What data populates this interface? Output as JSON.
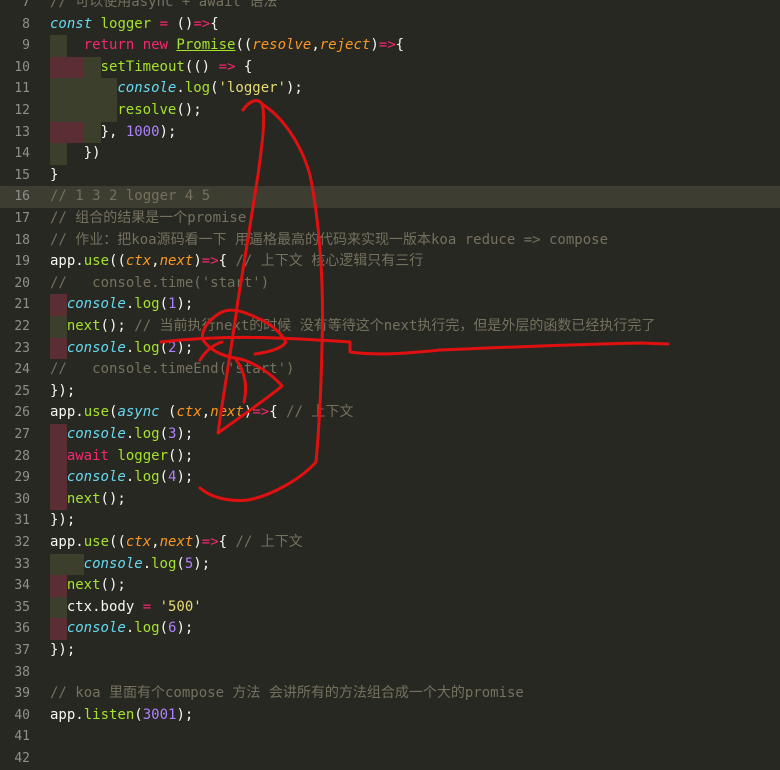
{
  "editor": {
    "lines": [
      {
        "n": "7",
        "t": [
          [
            "cmt",
            "// 可以使用async + await 语法"
          ]
        ]
      },
      {
        "n": "8",
        "t": [
          [
            "sto",
            "const"
          ],
          [
            "",
            "&nbsp;"
          ],
          [
            "fn",
            "logger"
          ],
          [
            "",
            " "
          ],
          [
            "kw",
            "="
          ],
          [
            "",
            " ()"
          ],
          [
            "kw",
            "=>"
          ],
          [
            "",
            "{"
          ]
        ]
      },
      {
        "n": "9",
        "t": [
          [
            "kw",
            "return"
          ],
          [
            "",
            " "
          ],
          [
            "kw",
            "new"
          ],
          [
            "",
            " "
          ],
          [
            "cls",
            "Promise"
          ],
          [
            "",
            "(("
          ],
          [
            "par",
            "resolve"
          ],
          [
            "",
            ","
          ],
          [
            "par",
            "reject"
          ],
          [
            "",
            ")"
          ],
          [
            "kw",
            "=>"
          ],
          [
            "",
            "{"
          ]
        ]
      },
      {
        "n": "10",
        "t": [
          [
            "fn",
            "setTimeout"
          ],
          [
            "",
            "(() "
          ],
          [
            "kw",
            "=>"
          ],
          [
            "",
            " {"
          ]
        ]
      },
      {
        "n": "11",
        "t": [
          [
            "sto",
            "console"
          ],
          [
            "",
            "."
          ],
          [
            "fn",
            "log"
          ],
          [
            "",
            "("
          ],
          [
            "str",
            "'logger'"
          ],
          [
            "",
            ");"
          ]
        ]
      },
      {
        "n": "12",
        "t": [
          [
            "fn",
            "resolve"
          ],
          [
            "",
            "();"
          ]
        ]
      },
      {
        "n": "13",
        "t": [
          [
            "",
            "}, "
          ],
          [
            "num",
            "1000"
          ],
          [
            "",
            ");"
          ]
        ]
      },
      {
        "n": "14",
        "t": [
          [
            "",
            "})"
          ]
        ]
      },
      {
        "n": "15",
        "t": [
          [
            "",
            "}"
          ]
        ]
      },
      {
        "n": "16",
        "t": [
          [
            "cmt",
            "// 1 3 2 logger 4 5"
          ]
        ]
      },
      {
        "n": "17",
        "t": [
          [
            "cmt",
            "// 组合的结果是一个promise"
          ]
        ]
      },
      {
        "n": "18",
        "t": [
          [
            "cmt",
            "// 作业：把koa源码看一下 用逼格最高的代码来实现一版本koa reduce => compose"
          ]
        ]
      },
      {
        "n": "19",
        "t": [
          [
            "",
            "app."
          ],
          [
            "fn",
            "use"
          ],
          [
            "",
            "(("
          ],
          [
            "par",
            "ctx"
          ],
          [
            "",
            ","
          ],
          [
            "par",
            "next"
          ],
          [
            "",
            ")"
          ],
          [
            "kw",
            "=>"
          ],
          [
            "",
            "{ "
          ],
          [
            "cmt",
            "// 上下文 核心逻辑只有三行"
          ]
        ]
      },
      {
        "n": "20",
        "t": [
          [
            "cmt",
            "//   console.time('start')"
          ]
        ]
      },
      {
        "n": "21",
        "t": [
          [
            "sto",
            "console"
          ],
          [
            "",
            "."
          ],
          [
            "fn",
            "log"
          ],
          [
            "",
            "("
          ],
          [
            "num",
            "1"
          ],
          [
            "",
            ");"
          ]
        ]
      },
      {
        "n": "22",
        "t": [
          [
            "fn",
            "next"
          ],
          [
            "",
            "(); "
          ],
          [
            "cmt",
            "// 当前执行next的时候 没有等待这个next执行完，但是外层的函数已经执行完了"
          ]
        ]
      },
      {
        "n": "23",
        "t": [
          [
            "sto",
            "console"
          ],
          [
            "",
            "."
          ],
          [
            "fn",
            "log"
          ],
          [
            "",
            "("
          ],
          [
            "num",
            "2"
          ],
          [
            "",
            ");"
          ]
        ]
      },
      {
        "n": "24",
        "t": [
          [
            "cmt",
            "//   console.timeEnd('start')"
          ]
        ]
      },
      {
        "n": "25",
        "t": [
          [
            "",
            "});"
          ]
        ]
      },
      {
        "n": "26",
        "t": [
          [
            "",
            "app."
          ],
          [
            "fn",
            "use"
          ],
          [
            "",
            "("
          ],
          [
            "sto",
            "async"
          ],
          [
            "",
            " ("
          ],
          [
            "par",
            "ctx"
          ],
          [
            "",
            ","
          ],
          [
            "par",
            "next"
          ],
          [
            "",
            ")"
          ],
          [
            "kw",
            "=>"
          ],
          [
            "",
            "{ "
          ],
          [
            "cmt",
            "// 上下文"
          ]
        ]
      },
      {
        "n": "27",
        "t": [
          [
            "sto",
            "console"
          ],
          [
            "",
            "."
          ],
          [
            "fn",
            "log"
          ],
          [
            "",
            "("
          ],
          [
            "num",
            "3"
          ],
          [
            "",
            ");"
          ]
        ]
      },
      {
        "n": "28",
        "t": [
          [
            "kw",
            "await"
          ],
          [
            "",
            " "
          ],
          [
            "fn",
            "logger"
          ],
          [
            "",
            "();"
          ]
        ]
      },
      {
        "n": "29",
        "t": [
          [
            "sto",
            "console"
          ],
          [
            "",
            "."
          ],
          [
            "fn",
            "log"
          ],
          [
            "",
            "("
          ],
          [
            "num",
            "4"
          ],
          [
            "",
            ");"
          ]
        ]
      },
      {
        "n": "30",
        "t": [
          [
            "fn",
            "next"
          ],
          [
            "",
            "();"
          ]
        ]
      },
      {
        "n": "31",
        "t": [
          [
            "",
            "});"
          ]
        ]
      },
      {
        "n": "32",
        "t": [
          [
            "",
            "app."
          ],
          [
            "fn",
            "use"
          ],
          [
            "",
            "(("
          ],
          [
            "par",
            "ctx"
          ],
          [
            "",
            ","
          ],
          [
            "par",
            "next"
          ],
          [
            "",
            ")"
          ],
          [
            "kw",
            "=>"
          ],
          [
            "",
            "{ "
          ],
          [
            "cmt",
            "// 上下文"
          ]
        ]
      },
      {
        "n": "33",
        "t": [
          [
            "sto",
            "console"
          ],
          [
            "",
            "."
          ],
          [
            "fn",
            "log"
          ],
          [
            "",
            "("
          ],
          [
            "num",
            "5"
          ],
          [
            "",
            ");"
          ]
        ]
      },
      {
        "n": "34",
        "t": [
          [
            "fn",
            "next"
          ],
          [
            "",
            "();"
          ]
        ]
      },
      {
        "n": "35",
        "t": [
          [
            "",
            "ctx.body "
          ],
          [
            "kw",
            "="
          ],
          [
            "",
            " "
          ],
          [
            "str",
            "'500'"
          ]
        ]
      },
      {
        "n": "36",
        "t": [
          [
            "sto",
            "console"
          ],
          [
            "",
            "."
          ],
          [
            "fn",
            "log"
          ],
          [
            "",
            "("
          ],
          [
            "num",
            "6"
          ],
          [
            "",
            ");"
          ]
        ]
      },
      {
        "n": "37",
        "t": [
          [
            "",
            "});"
          ]
        ]
      },
      {
        "n": "38",
        "t": []
      },
      {
        "n": "39",
        "t": [
          [
            "cmt",
            "// koa 里面有个compose 方法 会讲所有的方法组合成一个大的promise"
          ]
        ]
      },
      {
        "n": "40",
        "t": [
          [
            "",
            "app."
          ],
          [
            "fn",
            "listen"
          ],
          [
            "",
            "("
          ],
          [
            "num",
            "3001"
          ],
          [
            "",
            ");"
          ]
        ]
      },
      {
        "n": "41",
        "t": []
      },
      {
        "n": "42",
        "t": []
      }
    ]
  },
  "colors": {
    "background": "#272822",
    "annotation": "#e01010"
  }
}
